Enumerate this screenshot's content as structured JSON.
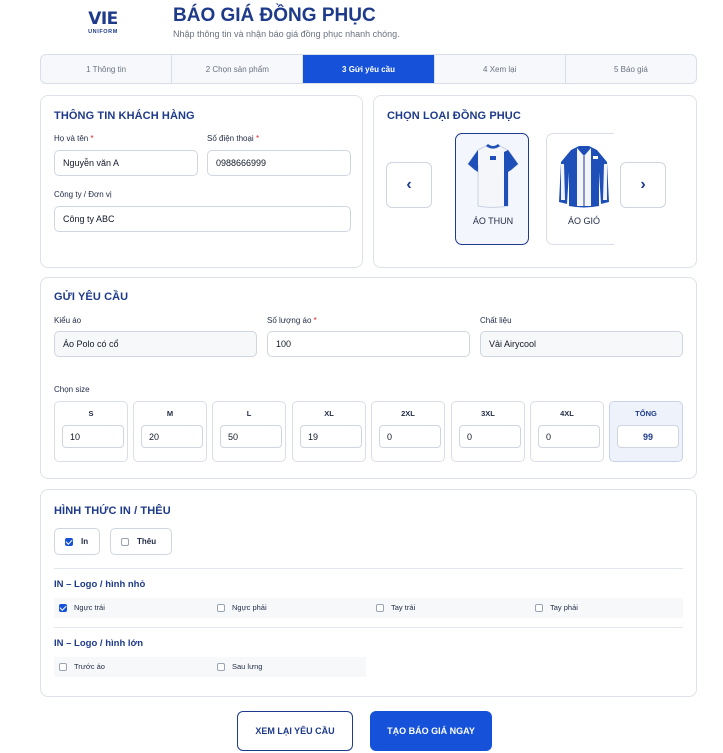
{
  "header": {
    "logo_main": "VIE",
    "logo_sub": "UNIFORM",
    "title": "BÁO GIÁ ĐỒNG PHỤC",
    "subtitle": "Nhập thông tin và nhận báo giá đồng phục nhanh chóng."
  },
  "steps": [
    {
      "label": "1 Thông tin",
      "active": false
    },
    {
      "label": "2 Chọn sản phẩm",
      "active": false
    },
    {
      "label": "3 Gửi yêu cầu",
      "active": true
    },
    {
      "label": "4 Xem lại",
      "active": false
    },
    {
      "label": "5 Báo giá",
      "active": false
    }
  ],
  "customer": {
    "title": "THÔNG TIN KHÁCH HÀNG",
    "name_label": "Họ và tên",
    "name_value": "Nguyễn văn A",
    "phone_label": "Số điện thoại",
    "phone_value": "0988666999",
    "company_label": "Công ty / Đơn vị",
    "company_value": "Công ty ABC",
    "required_mark": "*"
  },
  "uniform_type": {
    "title": "CHỌN LOẠI ĐỒNG PHỤC",
    "prev_icon": "‹",
    "next_icon": "›",
    "items": [
      {
        "label": "ÁO THUN",
        "selected": true
      },
      {
        "label": "ÁO GIÓ",
        "selected": false
      }
    ]
  },
  "request": {
    "title": "GỬI YÊU CẦU",
    "style_label": "Kiểu áo",
    "style_value": "Áo Polo có cổ",
    "qty_label": "Số lượng áo",
    "qty_value": "100",
    "material_label": "Chất liệu",
    "material_value": "Vải Airycool",
    "size_label": "Chọn size",
    "sizes": [
      {
        "label": "S",
        "value": "10"
      },
      {
        "label": "M",
        "value": "20"
      },
      {
        "label": "L",
        "value": "50"
      },
      {
        "label": "XL",
        "value": "19"
      },
      {
        "label": "2XL",
        "value": "0"
      },
      {
        "label": "3XL",
        "value": "0"
      },
      {
        "label": "4XL",
        "value": "0"
      }
    ],
    "total_label": "TỔNG",
    "total_value": "99"
  },
  "print": {
    "title": "HÌNH THỨC IN / THÊU",
    "methods": [
      {
        "label": "In",
        "checked": true
      },
      {
        "label": "Thêu",
        "checked": false
      }
    ],
    "small_title": "IN – Logo / hình nhỏ",
    "small_options": [
      {
        "label": "Ngực trái",
        "checked": true
      },
      {
        "label": "Ngực phải",
        "checked": false
      },
      {
        "label": "Tay trái",
        "checked": false
      },
      {
        "label": "Tay phải",
        "checked": false
      }
    ],
    "large_title": "IN – Logo / hình lớn",
    "large_options": [
      {
        "label": "Trước áo",
        "checked": false
      },
      {
        "label": "Sau lưng",
        "checked": false
      }
    ]
  },
  "actions": {
    "review_label": "XEM LẠI YÊU CẦU",
    "submit_label": "TẠO BÁO GIÁ NGAY"
  },
  "colors": {
    "primary": "#1652d9",
    "brand_navy": "#1e3a8a",
    "required": "#dc2626"
  }
}
